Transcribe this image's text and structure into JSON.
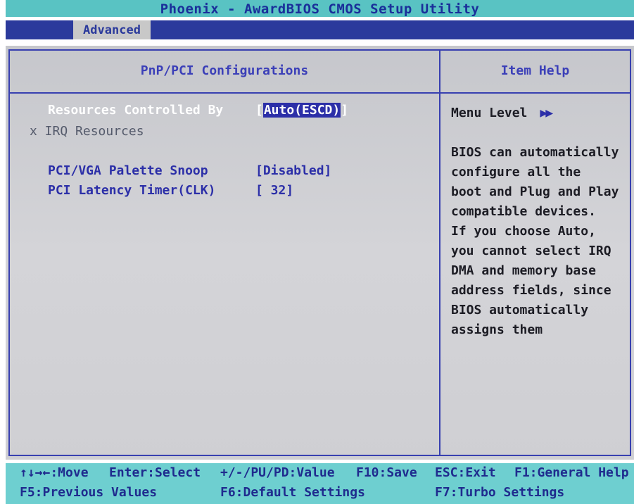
{
  "title": "Phoenix - AwardBIOS CMOS Setup Utility",
  "menu": {
    "active_tab": "Advanced"
  },
  "page": {
    "header": "PnP/PCI Configurations",
    "help_header": "Item Help"
  },
  "settings": [
    {
      "label": "Resources Controlled By",
      "value": "Auto(ESCD)",
      "selected": true
    },
    {
      "label": "x IRQ Resources",
      "value": "",
      "disabled": true
    },
    {
      "label": "PCI/VGA Palette Snoop",
      "value": "[Disabled]"
    },
    {
      "label": "PCI Latency Timer(CLK)",
      "value": "[ 32]"
    }
  ],
  "help": {
    "menu_level_label": "Menu Level",
    "menu_level_icon": "double-right-arrow-icon",
    "lines": [
      "BIOS can automatically",
      "configure all the",
      "boot and Plug and Play",
      "compatible devices.",
      "If you choose Auto,",
      "you cannot select IRQ",
      "DMA and memory base",
      "address fields, since",
      "BIOS automatically",
      "assigns them"
    ]
  },
  "keys": {
    "row1": [
      "↑↓→←:Move",
      "Enter:Select",
      "+/-/PU/PD:Value",
      "F10:Save",
      "ESC:Exit",
      "F1:General Help"
    ],
    "row2": [
      "F5:Previous Values",
      "F6:Default Settings",
      "F7:Turbo Settings"
    ]
  },
  "colors": {
    "title_bg": "#59c3c3",
    "menu_bg": "#2b3a9c",
    "panel_bg": "#c6c7cc",
    "accent_blue": "#2c2fa8",
    "key_bar_bg": "#6ecfd0"
  }
}
